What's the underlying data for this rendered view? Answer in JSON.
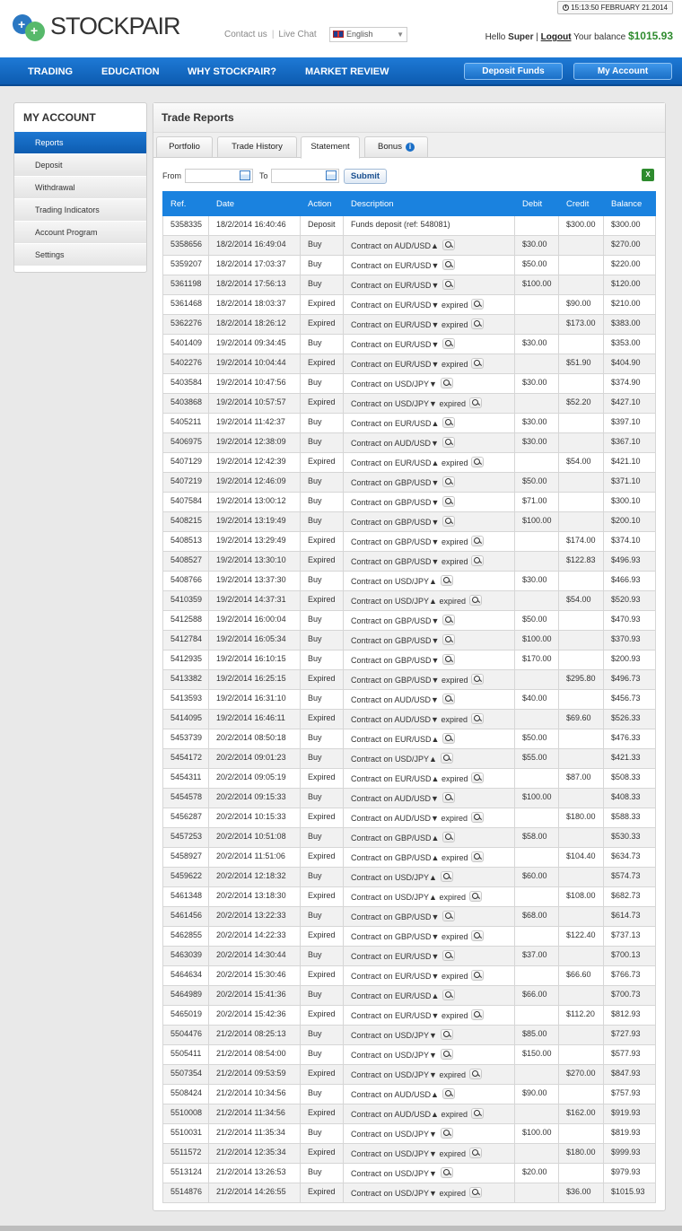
{
  "header": {
    "clock": "15:13:50 FEBRUARY 21.2014",
    "logo_text": "STOCKPAIR",
    "contact_us": "Contact us",
    "live_chat": "Live Chat",
    "language": "English",
    "hello": "Hello",
    "username": "Super",
    "logout": "Logout",
    "balance_label": "Your balance",
    "balance": "$1015.93"
  },
  "nav": {
    "items": [
      "TRADING",
      "EDUCATION",
      "WHY STOCKPAIR?",
      "MARKET REVIEW"
    ],
    "deposit_button": "Deposit Funds",
    "account_button": "My Account"
  },
  "sidebar": {
    "title": "MY ACCOUNT",
    "items": [
      "Reports",
      "Deposit",
      "Withdrawal",
      "Trading Indicators",
      "Account Program",
      "Settings"
    ]
  },
  "main": {
    "title": "Trade Reports",
    "tabs": [
      "Portfolio",
      "Trade History",
      "Statement",
      "Bonus"
    ],
    "filter": {
      "from": "From",
      "to": "To",
      "submit": "Submit",
      "from_value": "",
      "to_value": ""
    },
    "columns": [
      "Ref.",
      "Date",
      "Action",
      "Description",
      "Debit",
      "Credit",
      "Balance"
    ],
    "rows": [
      [
        "5358335",
        "18/2/2014 16:40:46",
        "Deposit",
        "Funds deposit (ref: 548081)",
        "",
        "$300.00",
        "$300.00"
      ],
      [
        "5358656",
        "18/2/2014 16:49:04",
        "Buy",
        "Contract on AUD/USD▲",
        "$30.00",
        "",
        "$270.00"
      ],
      [
        "5359207",
        "18/2/2014 17:03:37",
        "Buy",
        "Contract on EUR/USD▼",
        "$50.00",
        "",
        "$220.00"
      ],
      [
        "5361198",
        "18/2/2014 17:56:13",
        "Buy",
        "Contract on EUR/USD▼",
        "$100.00",
        "",
        "$120.00"
      ],
      [
        "5361468",
        "18/2/2014 18:03:37",
        "Expired",
        "Contract on EUR/USD▼ expired",
        "",
        "$90.00",
        "$210.00"
      ],
      [
        "5362276",
        "18/2/2014 18:26:12",
        "Expired",
        "Contract on EUR/USD▼ expired",
        "",
        "$173.00",
        "$383.00"
      ],
      [
        "5401409",
        "19/2/2014 09:34:45",
        "Buy",
        "Contract on EUR/USD▼",
        "$30.00",
        "",
        "$353.00"
      ],
      [
        "5402276",
        "19/2/2014 10:04:44",
        "Expired",
        "Contract on EUR/USD▼ expired",
        "",
        "$51.90",
        "$404.90"
      ],
      [
        "5403584",
        "19/2/2014 10:47:56",
        "Buy",
        "Contract on USD/JPY▼",
        "$30.00",
        "",
        "$374.90"
      ],
      [
        "5403868",
        "19/2/2014 10:57:57",
        "Expired",
        "Contract on USD/JPY▼ expired",
        "",
        "$52.20",
        "$427.10"
      ],
      [
        "5405211",
        "19/2/2014 11:42:37",
        "Buy",
        "Contract on EUR/USD▲",
        "$30.00",
        "",
        "$397.10"
      ],
      [
        "5406975",
        "19/2/2014 12:38:09",
        "Buy",
        "Contract on AUD/USD▼",
        "$30.00",
        "",
        "$367.10"
      ],
      [
        "5407129",
        "19/2/2014 12:42:39",
        "Expired",
        "Contract on EUR/USD▲ expired",
        "",
        "$54.00",
        "$421.10"
      ],
      [
        "5407219",
        "19/2/2014 12:46:09",
        "Buy",
        "Contract on GBP/USD▼",
        "$50.00",
        "",
        "$371.10"
      ],
      [
        "5407584",
        "19/2/2014 13:00:12",
        "Buy",
        "Contract on GBP/USD▼",
        "$71.00",
        "",
        "$300.10"
      ],
      [
        "5408215",
        "19/2/2014 13:19:49",
        "Buy",
        "Contract on GBP/USD▼",
        "$100.00",
        "",
        "$200.10"
      ],
      [
        "5408513",
        "19/2/2014 13:29:49",
        "Expired",
        "Contract on GBP/USD▼ expired",
        "",
        "$174.00",
        "$374.10"
      ],
      [
        "5408527",
        "19/2/2014 13:30:10",
        "Expired",
        "Contract on GBP/USD▼ expired",
        "",
        "$122.83",
        "$496.93"
      ],
      [
        "5408766",
        "19/2/2014 13:37:30",
        "Buy",
        "Contract on USD/JPY▲",
        "$30.00",
        "",
        "$466.93"
      ],
      [
        "5410359",
        "19/2/2014 14:37:31",
        "Expired",
        "Contract on USD/JPY▲ expired",
        "",
        "$54.00",
        "$520.93"
      ],
      [
        "5412588",
        "19/2/2014 16:00:04",
        "Buy",
        "Contract on GBP/USD▼",
        "$50.00",
        "",
        "$470.93"
      ],
      [
        "5412784",
        "19/2/2014 16:05:34",
        "Buy",
        "Contract on GBP/USD▼",
        "$100.00",
        "",
        "$370.93"
      ],
      [
        "5412935",
        "19/2/2014 16:10:15",
        "Buy",
        "Contract on GBP/USD▼",
        "$170.00",
        "",
        "$200.93"
      ],
      [
        "5413382",
        "19/2/2014 16:25:15",
        "Expired",
        "Contract on GBP/USD▼ expired",
        "",
        "$295.80",
        "$496.73"
      ],
      [
        "5413593",
        "19/2/2014 16:31:10",
        "Buy",
        "Contract on AUD/USD▼",
        "$40.00",
        "",
        "$456.73"
      ],
      [
        "5414095",
        "19/2/2014 16:46:11",
        "Expired",
        "Contract on AUD/USD▼ expired",
        "",
        "$69.60",
        "$526.33"
      ],
      [
        "5453739",
        "20/2/2014 08:50:18",
        "Buy",
        "Contract on EUR/USD▲",
        "$50.00",
        "",
        "$476.33"
      ],
      [
        "5454172",
        "20/2/2014 09:01:23",
        "Buy",
        "Contract on USD/JPY▲",
        "$55.00",
        "",
        "$421.33"
      ],
      [
        "5454311",
        "20/2/2014 09:05:19",
        "Expired",
        "Contract on EUR/USD▲ expired",
        "",
        "$87.00",
        "$508.33"
      ],
      [
        "5454578",
        "20/2/2014 09:15:33",
        "Buy",
        "Contract on AUD/USD▼",
        "$100.00",
        "",
        "$408.33"
      ],
      [
        "5456287",
        "20/2/2014 10:15:33",
        "Expired",
        "Contract on AUD/USD▼ expired",
        "",
        "$180.00",
        "$588.33"
      ],
      [
        "5457253",
        "20/2/2014 10:51:08",
        "Buy",
        "Contract on GBP/USD▲",
        "$58.00",
        "",
        "$530.33"
      ],
      [
        "5458927",
        "20/2/2014 11:51:06",
        "Expired",
        "Contract on GBP/USD▲ expired",
        "",
        "$104.40",
        "$634.73"
      ],
      [
        "5459622",
        "20/2/2014 12:18:32",
        "Buy",
        "Contract on USD/JPY▲",
        "$60.00",
        "",
        "$574.73"
      ],
      [
        "5461348",
        "20/2/2014 13:18:30",
        "Expired",
        "Contract on USD/JPY▲ expired",
        "",
        "$108.00",
        "$682.73"
      ],
      [
        "5461456",
        "20/2/2014 13:22:33",
        "Buy",
        "Contract on GBP/USD▼",
        "$68.00",
        "",
        "$614.73"
      ],
      [
        "5462855",
        "20/2/2014 14:22:33",
        "Expired",
        "Contract on GBP/USD▼ expired",
        "",
        "$122.40",
        "$737.13"
      ],
      [
        "5463039",
        "20/2/2014 14:30:44",
        "Buy",
        "Contract on EUR/USD▼",
        "$37.00",
        "",
        "$700.13"
      ],
      [
        "5464634",
        "20/2/2014 15:30:46",
        "Expired",
        "Contract on EUR/USD▼ expired",
        "",
        "$66.60",
        "$766.73"
      ],
      [
        "5464989",
        "20/2/2014 15:41:36",
        "Buy",
        "Contract on EUR/USD▲",
        "$66.00",
        "",
        "$700.73"
      ],
      [
        "5465019",
        "20/2/2014 15:42:36",
        "Expired",
        "Contract on EUR/USD▼ expired",
        "",
        "$112.20",
        "$812.93"
      ],
      [
        "5504476",
        "21/2/2014 08:25:13",
        "Buy",
        "Contract on USD/JPY▼",
        "$85.00",
        "",
        "$727.93"
      ],
      [
        "5505411",
        "21/2/2014 08:54:00",
        "Buy",
        "Contract on USD/JPY▼",
        "$150.00",
        "",
        "$577.93"
      ],
      [
        "5507354",
        "21/2/2014 09:53:59",
        "Expired",
        "Contract on USD/JPY▼ expired",
        "",
        "$270.00",
        "$847.93"
      ],
      [
        "5508424",
        "21/2/2014 10:34:56",
        "Buy",
        "Contract on AUD/USD▲",
        "$90.00",
        "",
        "$757.93"
      ],
      [
        "5510008",
        "21/2/2014 11:34:56",
        "Expired",
        "Contract on AUD/USD▲ expired",
        "",
        "$162.00",
        "$919.93"
      ],
      [
        "5510031",
        "21/2/2014 11:35:34",
        "Buy",
        "Contract on USD/JPY▼",
        "$100.00",
        "",
        "$819.93"
      ],
      [
        "5511572",
        "21/2/2014 12:35:34",
        "Expired",
        "Contract on USD/JPY▼ expired",
        "",
        "$180.00",
        "$999.93"
      ],
      [
        "5513124",
        "21/2/2014 13:26:53",
        "Buy",
        "Contract on USD/JPY▼",
        "$20.00",
        "",
        "$979.93"
      ],
      [
        "5514876",
        "21/2/2014 14:26:55",
        "Expired",
        "Contract on USD/JPY▼ expired",
        "",
        "$36.00",
        "$1015.93"
      ]
    ]
  },
  "colors": {
    "accent": "#1a82df",
    "nav": "#0d5cb0",
    "balance": "#2e8b2e"
  },
  "icons": [
    "clock-icon",
    "language-flag-icon",
    "info-icon",
    "calendar-icon",
    "excel-export-icon",
    "magnifier-icon"
  ]
}
